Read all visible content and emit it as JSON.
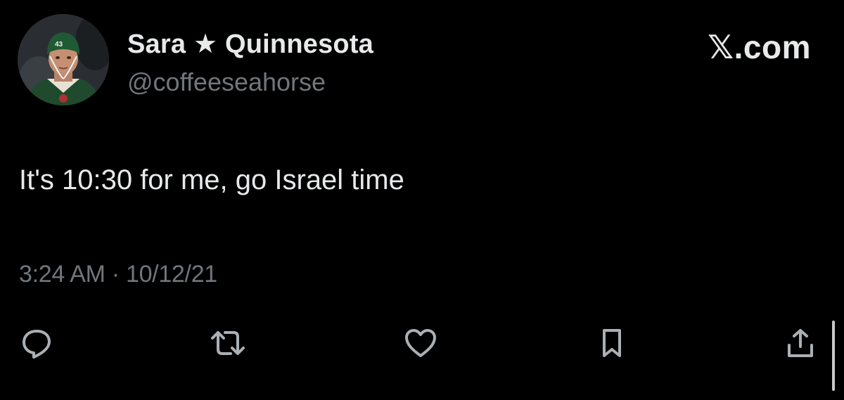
{
  "user": {
    "display_name": "Sara ★ Quinnesota",
    "handle": "@coffeeseahorse",
    "avatar_icon": "avatar-hockey-player"
  },
  "brand": {
    "label": "𝕏.com"
  },
  "tweet": {
    "text": "It's 10:30 for me, go Israel time",
    "timestamp": "3:24 AM · 10/12/21"
  },
  "actions": {
    "reply_icon": "reply-icon",
    "retweet_icon": "retweet-icon",
    "like_icon": "heart-icon",
    "bookmark_icon": "bookmark-icon",
    "share_icon": "share-icon"
  },
  "colors": {
    "background": "#000000",
    "primary_text": "#e7e9ea",
    "secondary_text": "#71767b",
    "icon": "#aab0b5"
  }
}
